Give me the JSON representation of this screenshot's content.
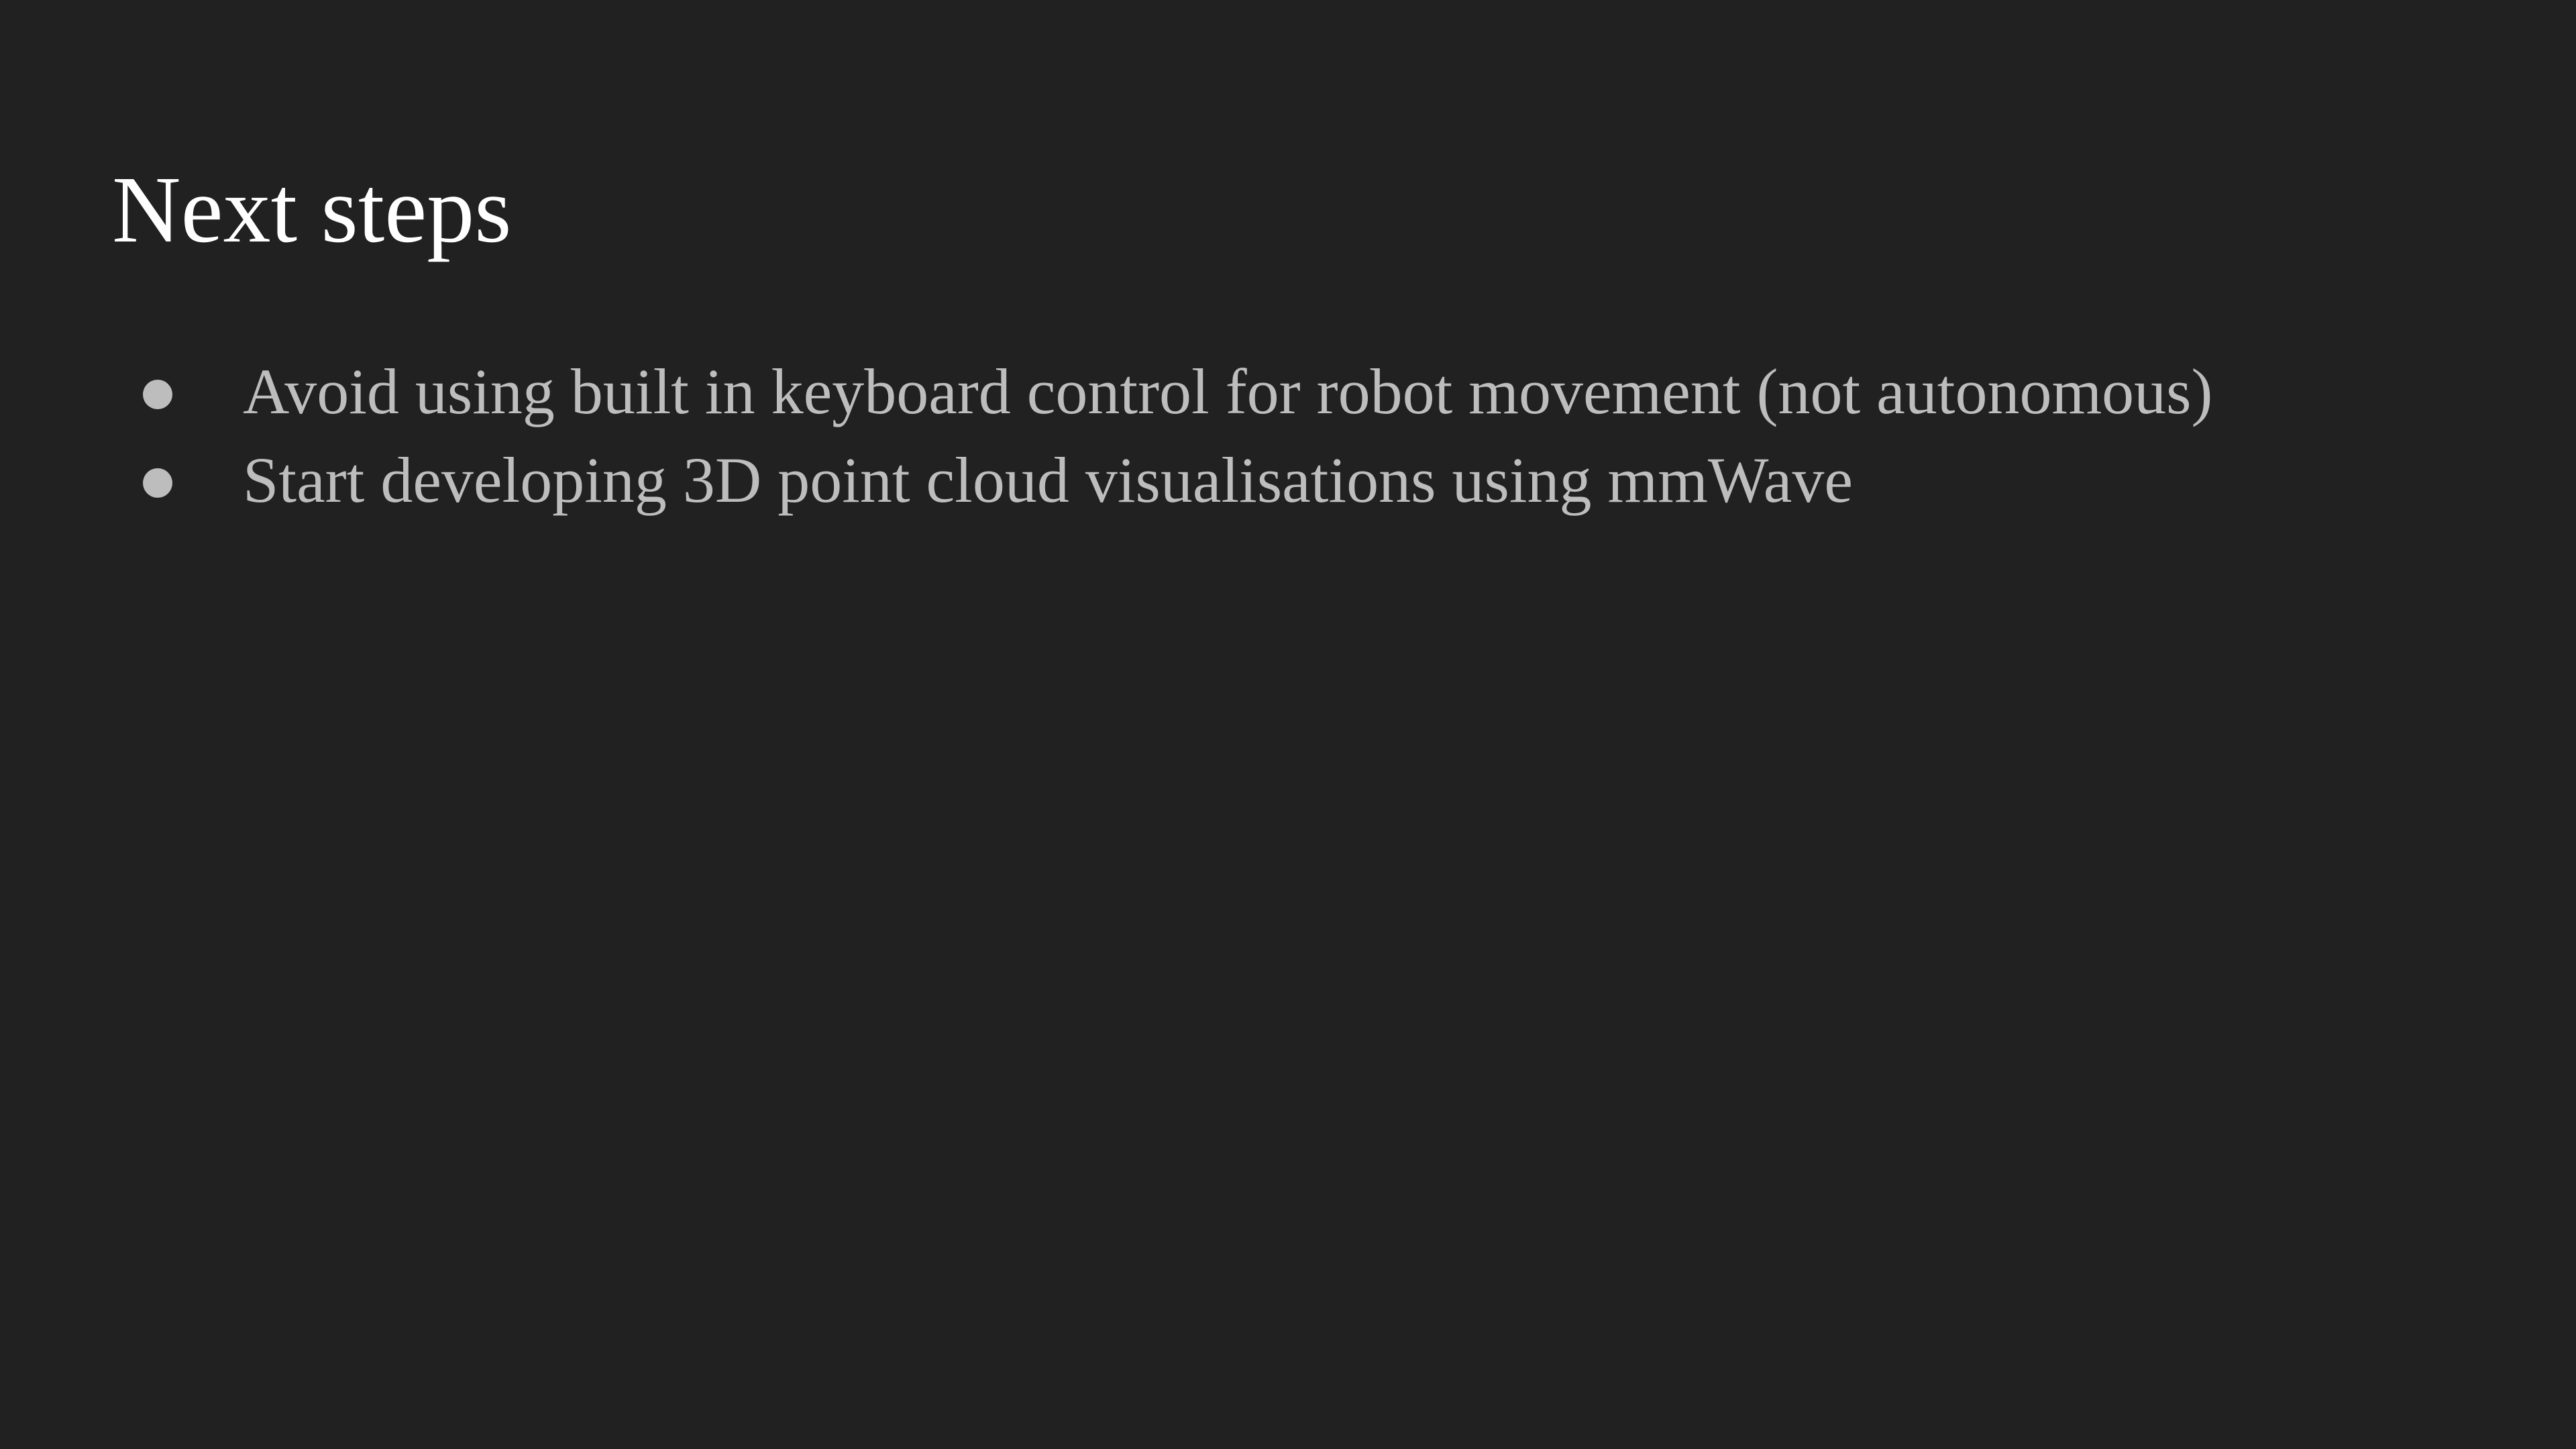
{
  "slide": {
    "title": "Next steps",
    "bullets": [
      "Avoid using built in keyboard control for robot movement (not autonomous)",
      "Start developing 3D point cloud visualisations using mmWave"
    ]
  },
  "colors": {
    "background": "#212121",
    "title": "#ffffff",
    "body_text": "#bdbdbd"
  }
}
